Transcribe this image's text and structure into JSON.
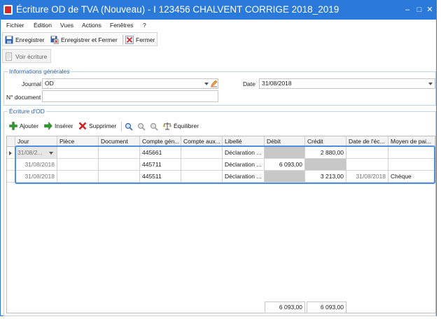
{
  "window": {
    "title": "Écriture OD de TVA (Nouveau) - I 123456 CHALVENT CORRIGE 2018_2019"
  },
  "menu": [
    "Fichier",
    "Édition",
    "Vues",
    "Actions",
    "Fenêtres",
    "?"
  ],
  "toolbar": {
    "save_label": "Enregistrer",
    "save_close_label": "Enregistrer et Fermer",
    "close_label": "Fermer",
    "view_entry_label": "Voir écriture"
  },
  "general": {
    "section_title": "Informations générales",
    "journal_label": "Journal",
    "journal_value": "OD",
    "date_label": "Date",
    "date_value": "31/08/2018",
    "doc_label": "N° document",
    "doc_value": ""
  },
  "entry": {
    "section_title": "Écriture d'OD",
    "add_label": "Ajouter",
    "insert_label": "Insérer",
    "delete_label": "Supprimer",
    "balance_label": "Équilibrer"
  },
  "grid": {
    "columns": [
      "Jour",
      "Pièce",
      "Document",
      "Compte gén...",
      "Compte aux...",
      "Libellé",
      "Débit",
      "Crédit",
      "Date de l'éc...",
      "Moyen de pai..."
    ],
    "rows": [
      {
        "jour": "31/08/2...",
        "piece": "",
        "document": "",
        "compte_gen": "445661",
        "compte_aux": "",
        "libelle": "Déclaration ...",
        "debit": "",
        "credit": "2 880,00",
        "date_ech": "",
        "moyen": ""
      },
      {
        "jour": "31/08/2018",
        "piece": "",
        "document": "",
        "compte_gen": "445711",
        "compte_aux": "",
        "libelle": "Déclaration ...",
        "debit": "6 093,00",
        "credit": "",
        "date_ech": "",
        "moyen": ""
      },
      {
        "jour": "31/08/2018",
        "piece": "",
        "document": "",
        "compte_gen": "445511",
        "compte_aux": "",
        "libelle": "Déclaration ...",
        "debit": "",
        "credit": "3 213,00",
        "date_ech": "31/08/2018",
        "moyen": "Chèque"
      }
    ],
    "totals": {
      "debit": "6 093,00",
      "credit": "6 093,00"
    }
  },
  "colors": {
    "accent": "#2b79d8",
    "title_text": "#ffffff",
    "section": "#2b5fa8"
  }
}
